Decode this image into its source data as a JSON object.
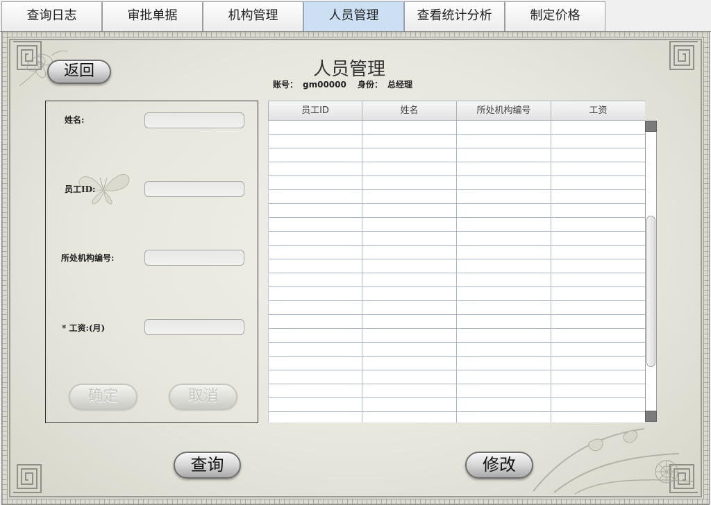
{
  "tabs": [
    {
      "label": "查询日志",
      "active": false
    },
    {
      "label": "审批单据",
      "active": false
    },
    {
      "label": "机构管理",
      "active": false
    },
    {
      "label": "人员管理",
      "active": true
    },
    {
      "label": "查看统计分析",
      "active": false
    },
    {
      "label": "制定价格",
      "active": false
    }
  ],
  "header": {
    "back_label": "返回",
    "title": "人员管理",
    "account_label": "账号：",
    "account_value": "gm00000",
    "identity_label": "身份：",
    "identity_value": "总经理"
  },
  "form": {
    "fields": [
      {
        "label": "姓名:",
        "value": ""
      },
      {
        "label": "员工ID:",
        "value": ""
      },
      {
        "label": "所处机构编号:",
        "value": ""
      },
      {
        "label": "* 工资:(月)",
        "value": ""
      }
    ],
    "confirm": {
      "label": "确定",
      "enabled": false
    },
    "cancel": {
      "label": "取消",
      "enabled": false
    }
  },
  "table": {
    "columns": [
      "员工ID",
      "姓名",
      "所处机构编号",
      "工资"
    ],
    "rows": []
  },
  "actions": {
    "query_label": "查询",
    "modify_label": "修改"
  },
  "icons": [
    "lattice-corner-icon",
    "flower-ornament-icon",
    "butterfly-ornament-icon",
    "orchid-ornament-icon"
  ],
  "colors": {
    "active_tab": "#cddff3",
    "panel_background": "#e7e7de",
    "grid_line": "#a9b8c9",
    "scrollbar_button": "#7b7b7b"
  }
}
